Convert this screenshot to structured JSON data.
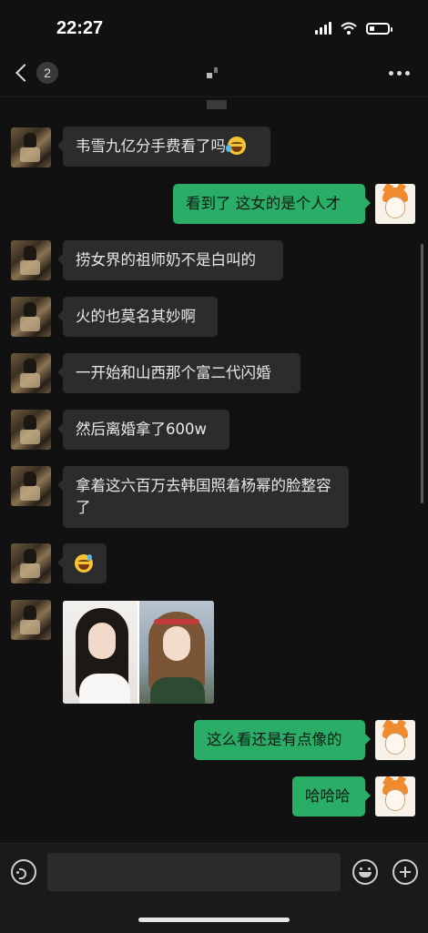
{
  "status_bar": {
    "time": "22:27",
    "battery_level": 0.3
  },
  "nav": {
    "unread_count": "2",
    "title_icon": "redacted-name-icon",
    "more_icon": "more-dots-icon"
  },
  "messages": [
    {
      "side": "in",
      "type": "text",
      "text": "韦雪九亿分手费看了吗",
      "emoji": "tears-of-joy"
    },
    {
      "side": "out",
      "type": "text",
      "text": "看到了 这女的是个人才"
    },
    {
      "side": "in",
      "type": "text",
      "text": "捞女界的祖师奶不是白叫的"
    },
    {
      "side": "in",
      "type": "text",
      "text": "火的也莫名其妙啊"
    },
    {
      "side": "in",
      "type": "text",
      "text": "一开始和山西那个富二代闪婚"
    },
    {
      "side": "in",
      "type": "text",
      "text": "然后离婚拿了600w"
    },
    {
      "side": "in",
      "type": "text",
      "text": "拿着这六百万去韩国照着杨幂的脸整容了"
    },
    {
      "side": "in",
      "type": "emoji",
      "emoji": "grinning-sweat"
    },
    {
      "side": "in",
      "type": "image",
      "description": "two-portraits-side-by-side"
    },
    {
      "side": "out",
      "type": "text",
      "text": "这么看还是有点像的"
    },
    {
      "side": "out",
      "type": "text",
      "text": "哈哈哈"
    }
  ],
  "input_bar": {
    "placeholder": "",
    "voice_icon": "voice-icon",
    "emoji_icon": "emoji-icon",
    "plus_icon": "plus-icon"
  },
  "colors": {
    "background": "#111111",
    "incoming_bubble": "#2c2c2c",
    "outgoing_bubble": "#2aae67"
  }
}
